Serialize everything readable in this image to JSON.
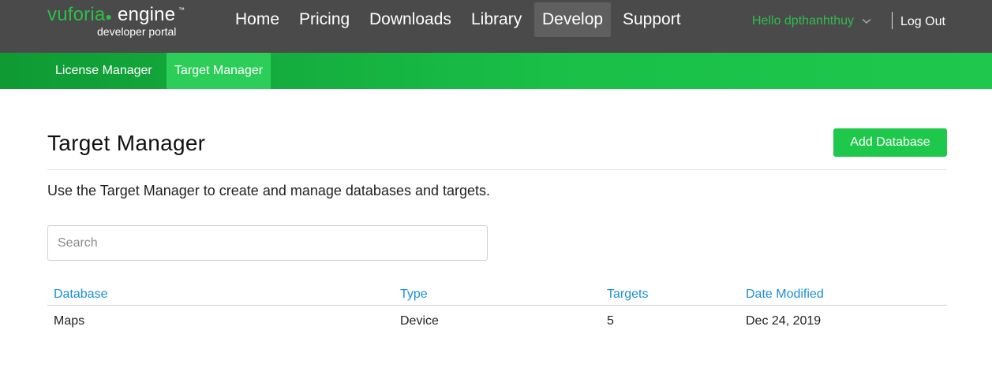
{
  "brand": {
    "logo_vuforia": "vuforia",
    "logo_engine": "engine",
    "logo_tm": "™",
    "logo_sub": "developer portal",
    "accent_green": "#2dbe4c",
    "header_bg": "#4a4a4a",
    "link_blue": "#1a8fd6"
  },
  "nav": {
    "items": [
      {
        "label": "Home"
      },
      {
        "label": "Pricing"
      },
      {
        "label": "Downloads"
      },
      {
        "label": "Library"
      },
      {
        "label": "Develop",
        "active": true
      },
      {
        "label": "Support"
      }
    ],
    "user_greeting": "Hello dpthanhthuy",
    "user_menu_icon": "chevron-down-icon",
    "logout_label": "Log Out"
  },
  "subnav": {
    "items": [
      {
        "label": "License Manager"
      },
      {
        "label": "Target Manager",
        "active": true
      }
    ]
  },
  "main": {
    "title": "Target Manager",
    "add_button_label": "Add Database",
    "description": "Use the Target Manager to create and manage databases and targets.",
    "search_placeholder": "Search"
  },
  "table": {
    "columns": [
      "Database",
      "Type",
      "Targets",
      "Date Modified"
    ],
    "rows": [
      [
        "Maps",
        "Device",
        "5",
        "Dec 24, 2019"
      ]
    ]
  }
}
